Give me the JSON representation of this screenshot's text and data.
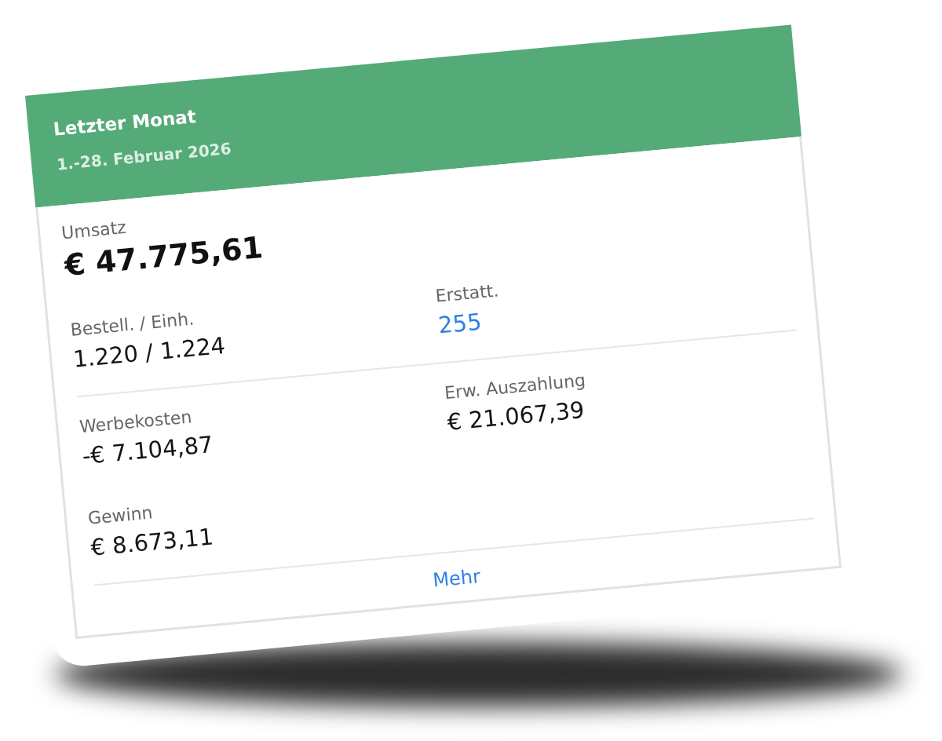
{
  "header": {
    "title": "Letzter Monat",
    "subtitle": "1.-28. Februar 2026"
  },
  "headline_metric": {
    "label": "Umsatz",
    "value": "€ 47.775,61"
  },
  "metric_rows": [
    {
      "metrics": [
        {
          "label": "Bestell. / Einh.",
          "value": "1.220 / 1.224",
          "kind": "plain"
        },
        {
          "label": "Erstatt.",
          "value": "255",
          "kind": "link"
        }
      ],
      "divider_below": true
    },
    {
      "metrics": [
        {
          "label": "Werbekosten",
          "value": "-€ 7.104,87",
          "kind": "plain"
        },
        {
          "label": "Erw. Auszahlung",
          "value": "€ 21.067,39",
          "kind": "plain"
        }
      ],
      "divider_below": false
    },
    {
      "metrics": [
        {
          "label": "Gewinn",
          "value": "€ 8.673,11",
          "kind": "plain"
        }
      ],
      "divider_below": true
    }
  ],
  "more_link": {
    "label": "Mehr"
  }
}
